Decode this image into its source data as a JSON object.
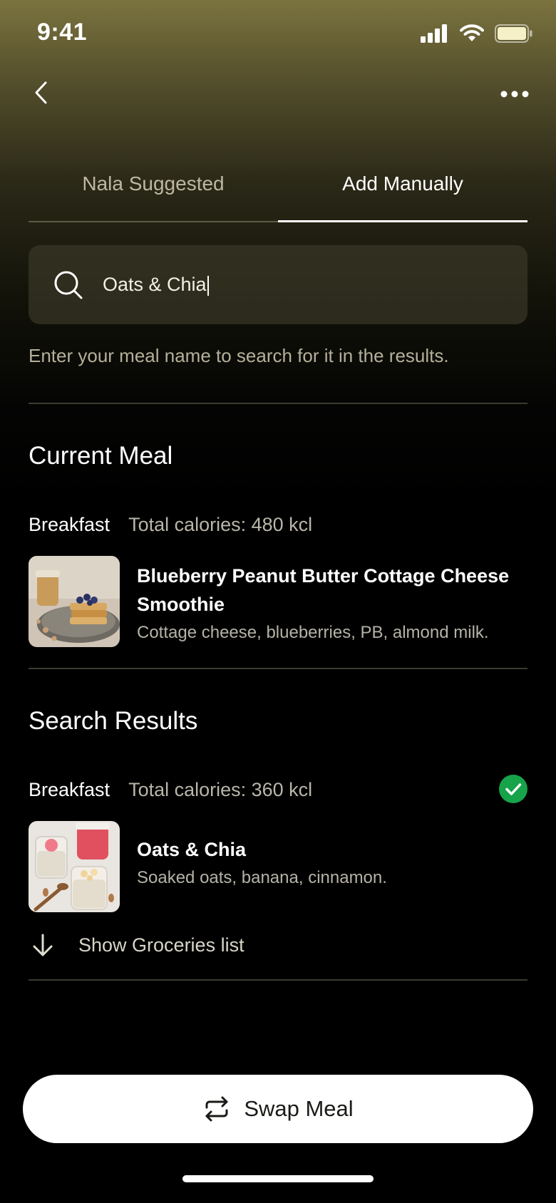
{
  "status_bar": {
    "time": "9:41"
  },
  "tabs": [
    {
      "label": "Nala Suggested",
      "active": false
    },
    {
      "label": "Add Manually",
      "active": true
    }
  ],
  "search": {
    "value": "Oats & Chia"
  },
  "hint": "Enter your meal name to search for it in the results.",
  "current_meal": {
    "title": "Current Meal",
    "meal_type": "Breakfast",
    "calories": "Total calories: 480 kcl",
    "name_line1": "Blueberry Peanut Butter Cottage Cheese",
    "name_line2": "Smoothie",
    "description": "Cottage cheese, blueberries, PB, almond milk."
  },
  "search_results": {
    "title": "Search Results",
    "meal_type": "Breakfast",
    "calories": "Total calories: 360 kcl",
    "selected": true,
    "name": "Oats & Chia",
    "description": "Soaked oats, banana, cinnamon."
  },
  "groceries_label": "Show Groceries list",
  "swap_button": "Swap Meal",
  "colors": {
    "accent_check": "#16a34a",
    "background_top": "#7b733f"
  }
}
